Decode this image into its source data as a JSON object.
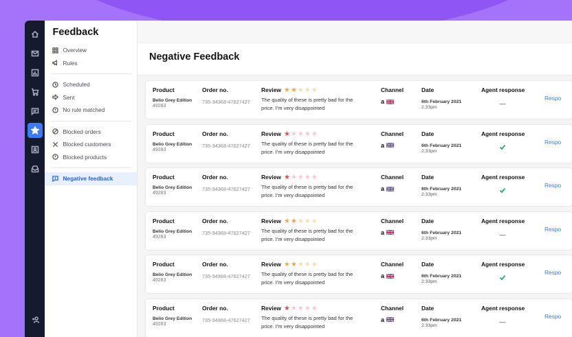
{
  "sidebar": {
    "title": "Feedback",
    "groups": [
      [
        {
          "label": "Overview",
          "icon": "grid-icon"
        },
        {
          "label": "Rules",
          "icon": "megaphone-icon"
        }
      ],
      [
        {
          "label": "Scheduled",
          "icon": "clock-icon"
        },
        {
          "label": "Sent",
          "icon": "arrow-right-icon"
        },
        {
          "label": "No rule matched",
          "icon": "info-icon"
        }
      ],
      [
        {
          "label": "Blocked orders",
          "icon": "ban-icon"
        },
        {
          "label": "Blocked customers",
          "icon": "x-icon"
        },
        {
          "label": "Blocked products",
          "icon": "alert-icon"
        }
      ],
      [
        {
          "label": "Negative feedback",
          "icon": "feedback-icon",
          "active": true
        }
      ]
    ]
  },
  "page": {
    "title": "Negative Feedback"
  },
  "columns": {
    "product": "Product",
    "order": "Order no.",
    "review": "Review",
    "channel": "Channel",
    "date": "Date",
    "agent": "Agent response"
  },
  "respond_label": "Respo",
  "colors": {
    "star_gold": "#f0a93b",
    "star_red": "#e04b5a",
    "star_empty_gold": "#f6dcae",
    "star_empty_red": "#f7c9cf",
    "accent": "#3b7cf6",
    "check": "#2fb37a"
  },
  "rows": [
    {
      "product_name": "Belio Grey Edition",
      "sku": "49283",
      "order_no": "735-34368-47627427",
      "rating": 2,
      "review": "The quality of these is pretty bad for the price. I'm very disappointed",
      "channel_logo": "a",
      "date": "6th February 2021",
      "time": "2:33pm",
      "agent_response": "none"
    },
    {
      "product_name": "Belio Grey Edition",
      "sku": "49283",
      "order_no": "735-34368-47627427",
      "rating": 1,
      "review": "The quality of these is pretty bad for the price. I'm very disappointed",
      "channel_logo": "a",
      "date": "6th February 2021",
      "time": "2:33pm",
      "agent_response": "done"
    },
    {
      "product_name": "Belio Grey Edition",
      "sku": "49283",
      "order_no": "735-34368-47627427",
      "rating": 1,
      "review": "The quality of these is pretty bad for the price. I'm very disappointed",
      "channel_logo": "a",
      "date": "6th February 2021",
      "time": "2:33pm",
      "agent_response": "done"
    },
    {
      "product_name": "Belio Grey Edition",
      "sku": "49283",
      "order_no": "735-34368-47627427",
      "rating": 2,
      "review": "The quality of these is pretty bad for the price. I'm very disappointed",
      "channel_logo": "a",
      "date": "6th February 2021",
      "time": "2:33pm",
      "agent_response": "none"
    },
    {
      "product_name": "Belio Grey Edition",
      "sku": "49283",
      "order_no": "735-34368-47627427",
      "rating": 2,
      "review": "The quality of these is pretty bad for the price. I'm very disappointed",
      "channel_logo": "a",
      "date": "6th February 2021",
      "time": "2:33pm",
      "agent_response": "done"
    },
    {
      "product_name": "Belio Grey Edition",
      "sku": "49283",
      "order_no": "735-34368-47627427",
      "rating": 1,
      "review": "The quality of these is pretty bad for the price. I'm very disappointed",
      "channel_logo": "a",
      "date": "6th February 2021",
      "time": "2:33pm",
      "agent_response": "none"
    }
  ]
}
